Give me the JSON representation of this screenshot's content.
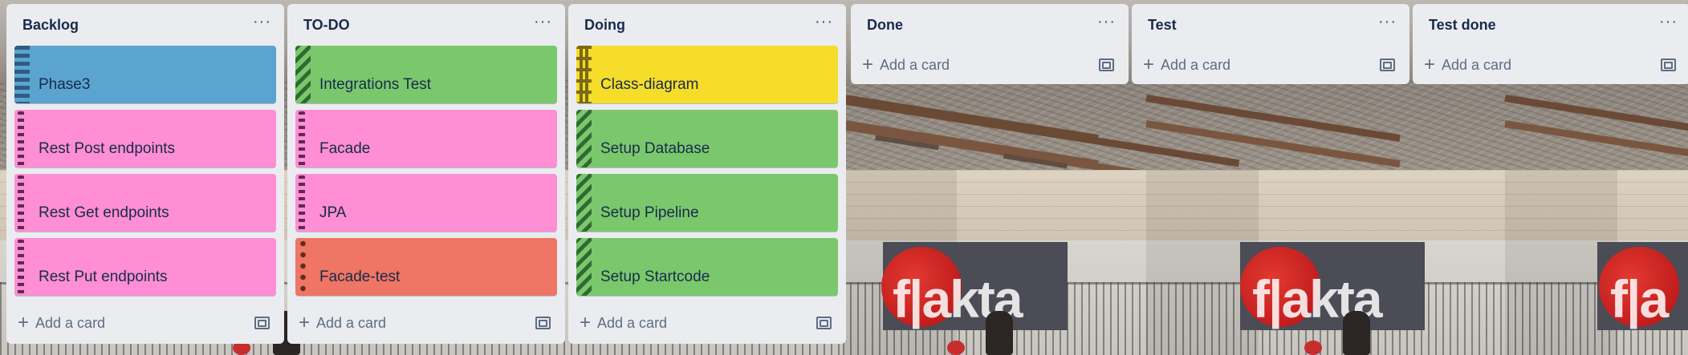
{
  "board": {
    "lists": [
      {
        "title": "Backlog",
        "menu": "···",
        "add_label": "Add a card",
        "cards": [
          {
            "title": "Phase3",
            "color": "#5ba4cf",
            "pattern": "hlines"
          },
          {
            "title": "Rest Post endpoints",
            "color": "#ff8ed4",
            "pattern": "dash"
          },
          {
            "title": "Rest Get endpoints",
            "color": "#ff8ed4",
            "pattern": "dash"
          },
          {
            "title": "Rest Put endpoints",
            "color": "#ff8ed4",
            "pattern": "dash"
          }
        ]
      },
      {
        "title": "TO-DO",
        "menu": "···",
        "add_label": "Add a card",
        "cards": [
          {
            "title": "Integrations Test",
            "color": "#7bc86c",
            "pattern": "diag"
          },
          {
            "title": "Facade",
            "color": "#ff8ed4",
            "pattern": "dash"
          },
          {
            "title": "JPA",
            "color": "#ff8ed4",
            "pattern": "dash"
          },
          {
            "title": "Facade-test",
            "color": "#ef7564",
            "pattern": "dots"
          }
        ]
      },
      {
        "title": "Doing",
        "menu": "···",
        "add_label": "Add a card",
        "cards": [
          {
            "title": "Class-diagram",
            "color": "#f5dd29",
            "pattern": "zigzag"
          },
          {
            "title": "Setup Database",
            "color": "#7bc86c",
            "pattern": "diag"
          },
          {
            "title": "Setup Pipeline",
            "color": "#7bc86c",
            "pattern": "diag"
          },
          {
            "title": "Setup Startcode",
            "color": "#7bc86c",
            "pattern": "diag"
          }
        ]
      },
      {
        "title": "Done",
        "menu": "···",
        "add_label": "Add a card",
        "cards": []
      },
      {
        "title": "Test",
        "menu": "···",
        "add_label": "Add a card",
        "cards": []
      },
      {
        "title": "Test done",
        "menu": "···",
        "add_label": "Add a card",
        "cards": []
      }
    ]
  },
  "icons": {
    "add": "plus-icon",
    "template": "card-template-icon",
    "menu": "more-icon"
  },
  "colors": {
    "list_bg": "#ebecf0",
    "text": "#172b4d",
    "muted": "#5e6c84"
  }
}
